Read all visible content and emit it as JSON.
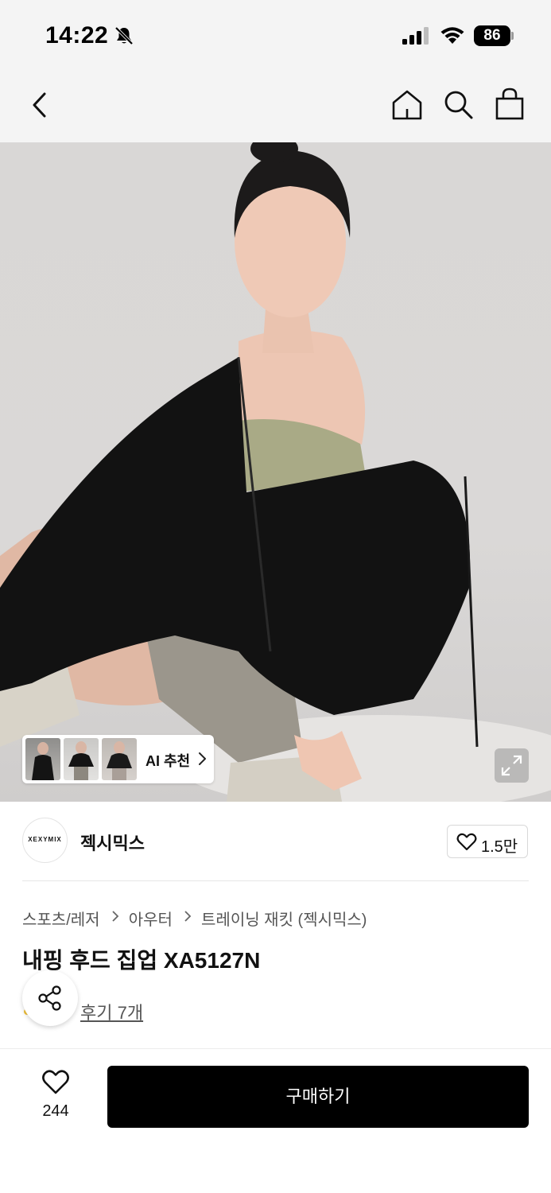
{
  "status_bar": {
    "time": "14:22",
    "battery_level": "86"
  },
  "nav": {
    "back_icon": "chevron-left-icon",
    "home_icon": "home-icon",
    "search_icon": "search-icon",
    "bag_icon": "shopping-bag-icon"
  },
  "hero": {
    "ai_recommend_label": "AI 추천",
    "thumbnail_count": 3,
    "expand_icon": "expand-icon"
  },
  "brand": {
    "logo_text": "XEXYMIX",
    "name": "젝시믹스",
    "like_count": "1.5만"
  },
  "product": {
    "breadcrumb": [
      "스포츠/레저",
      "아우터",
      "트레이닝 재킷 (젝시믹스)"
    ],
    "title": "내핑 후드 집업 XA5127N",
    "review_link": "후기 7개"
  },
  "bottom_bar": {
    "wish_count": "244",
    "buy_label": "구매하기"
  },
  "colors": {
    "header_bg": "#f4f4f4",
    "buy_button_bg": "#000000",
    "buy_button_text": "#ffffff"
  }
}
